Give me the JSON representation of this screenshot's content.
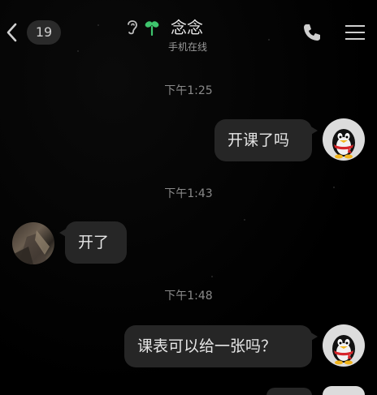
{
  "header": {
    "unread_count": "19",
    "contact_name": "念念",
    "presence": "手机在线"
  },
  "messages": [
    {
      "time": "下午1:25",
      "text": "开课了吗",
      "side": "right"
    },
    {
      "time": "下午1:43",
      "text": "开了",
      "side": "left"
    },
    {
      "time": "下午1:48",
      "text": "课表可以给一张吗？",
      "side": "right"
    }
  ],
  "colors": {
    "background": "#000000",
    "bubble": "#262626",
    "accent_sprout": "#3ec46d"
  },
  "icons": {
    "back": "chevron-left-icon",
    "ear": "ear-icon",
    "sprout": "sprout-icon",
    "call": "phone-icon",
    "menu": "hamburger-menu-icon"
  }
}
